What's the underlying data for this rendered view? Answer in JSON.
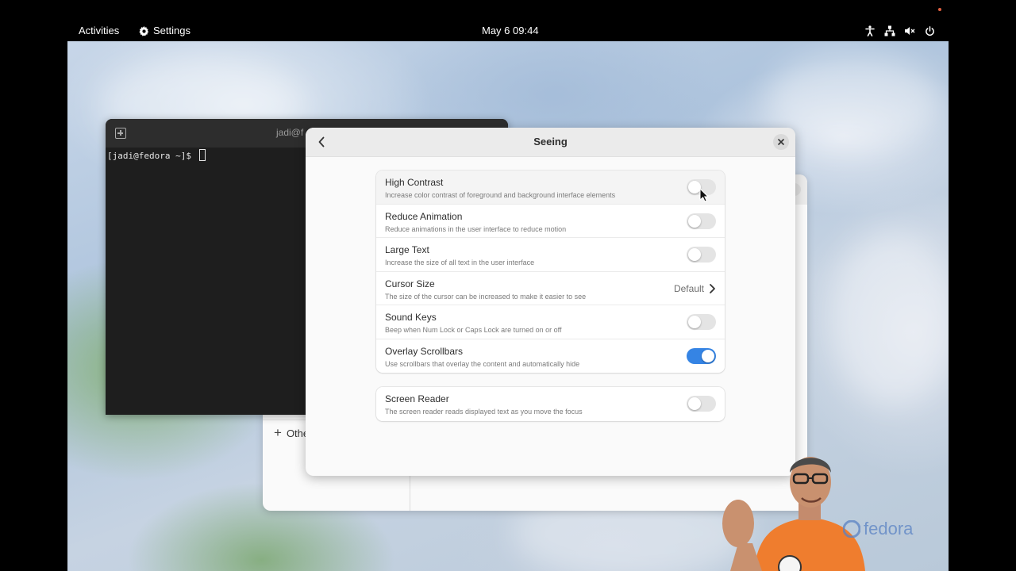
{
  "topbar": {
    "activities": "Activities",
    "app_menu": "Settings",
    "clock": "May 6  09:44",
    "tray_icons": [
      "accessibility-icon",
      "network-icon",
      "volume-muted-icon",
      "power-icon"
    ]
  },
  "terminal": {
    "title": "jadi@f",
    "prompt": "[jadi@fedora ~]$ "
  },
  "settings_background": {
    "sidebar_item": "Othe"
  },
  "dialog": {
    "title": "Seeing",
    "options": [
      {
        "title": "High Contrast",
        "subtitle": "Increase color contrast of foreground and background interface elements",
        "control": "switch",
        "enabled": false
      },
      {
        "title": "Reduce Animation",
        "subtitle": "Reduce animations in the user interface to reduce motion",
        "control": "switch",
        "enabled": false
      },
      {
        "title": "Large Text",
        "subtitle": "Increase the size of all text in the user interface",
        "control": "switch",
        "enabled": false
      },
      {
        "title": "Cursor Size",
        "subtitle": "The size of the cursor can be increased to make it easier to see",
        "control": "link",
        "value": "Default"
      },
      {
        "title": "Sound Keys",
        "subtitle": "Beep when Num Lock or Caps Lock are turned on or off",
        "control": "switch",
        "enabled": false
      },
      {
        "title": "Overlay Scrollbars",
        "subtitle": "Use scrollbars that overlay the content and automatically hide",
        "control": "switch",
        "enabled": true
      }
    ],
    "screen_reader": {
      "title": "Screen Reader",
      "subtitle": "The screen reader reads displayed text as you move the focus",
      "control": "switch",
      "enabled": false
    }
  },
  "watermark": {
    "text": "fedora"
  },
  "colors": {
    "accent": "#3584e4",
    "switch_off": "#e4e4e4",
    "topbar": "#000000"
  }
}
